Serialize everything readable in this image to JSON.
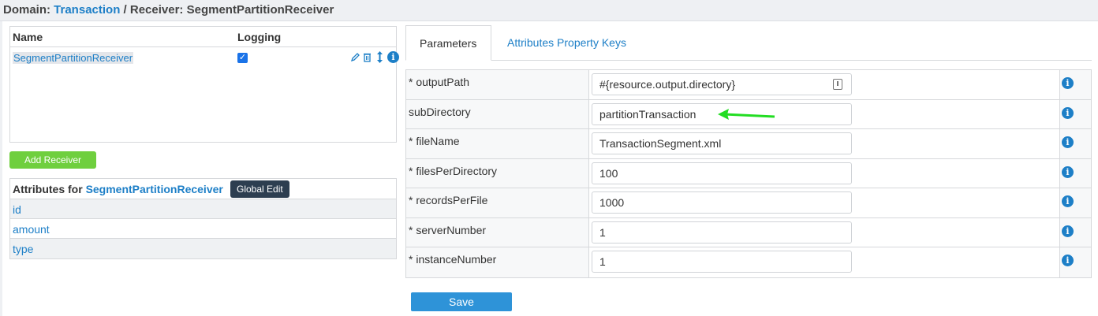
{
  "breadcrumb": {
    "domain_prefix": "Domain: ",
    "domain_link": "Transaction",
    "separator": " / Receiver: ",
    "receiver": "SegmentPartitionReceiver"
  },
  "receivers": {
    "col_name": "Name",
    "col_logging": "Logging",
    "rows": [
      {
        "name": "SegmentPartitionReceiver",
        "logging": true
      }
    ]
  },
  "add_receiver_label": "Add Receiver",
  "attributes": {
    "prefix": "Attributes for ",
    "receiver": "SegmentPartitionReceiver",
    "global_edit_label": "Global Edit",
    "items": [
      "id",
      "amount",
      "type"
    ]
  },
  "tabs": {
    "parameters": "Parameters",
    "attribute_keys": "Attributes Property Keys"
  },
  "params": [
    {
      "label": "* outputPath",
      "value": "#{resource.output.directory}"
    },
    {
      "label": "subDirectory",
      "value": "partitionTransaction"
    },
    {
      "label": "* fileName",
      "value": "TransactionSegment.xml"
    },
    {
      "label": "* filesPerDirectory",
      "value": "100"
    },
    {
      "label": "* recordsPerFile",
      "value": "1000"
    },
    {
      "label": "* serverNumber",
      "value": "1"
    },
    {
      "label": "* instanceNumber",
      "value": "1"
    }
  ],
  "save_label": "Save",
  "colors": {
    "link": "#1d7fc7",
    "add_button": "#6fcf3e",
    "save_button": "#2e93d8",
    "global_edit": "#2d3e50",
    "arrow": "#22dd22"
  },
  "icons": {
    "edit": "pencil-icon",
    "delete": "trash-icon",
    "move": "up-down-arrow-icon",
    "info": "info-icon",
    "file": "file-picker-icon"
  }
}
